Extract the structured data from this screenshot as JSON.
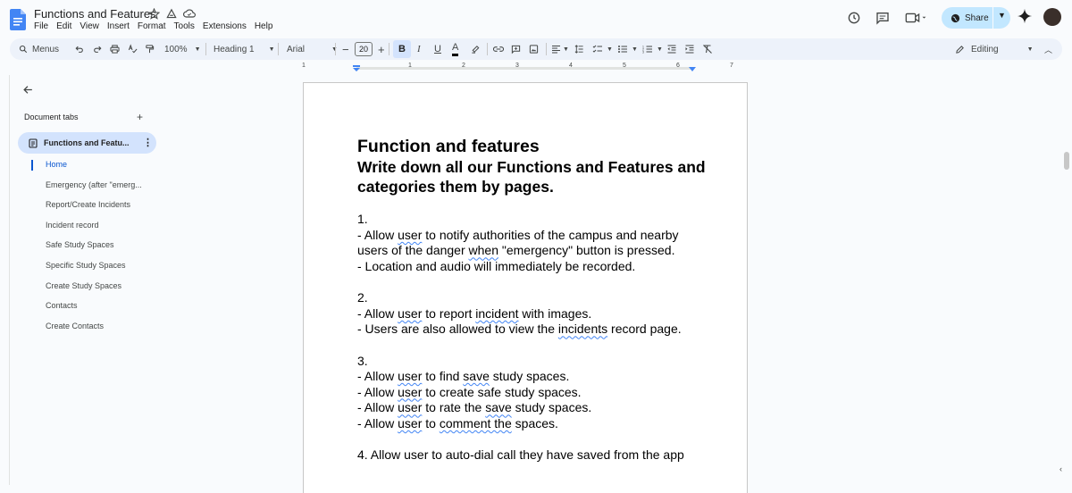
{
  "window": {
    "title": "Functions and Features",
    "menu": [
      "File",
      "Edit",
      "View",
      "Insert",
      "Format",
      "Tools",
      "Extensions",
      "Help"
    ]
  },
  "header": {
    "share_label": "Share"
  },
  "toolbar": {
    "menus_label": "Menus",
    "zoom": "100%",
    "style": "Heading 1",
    "font": "Arial",
    "font_size": "20",
    "bold": "B",
    "italic": "I",
    "underline": "U",
    "text_color": "A",
    "mode": "Editing"
  },
  "ruler": {
    "ticks": [
      "1",
      "1",
      "2",
      "3",
      "4",
      "5",
      "6",
      "7"
    ]
  },
  "sidebar": {
    "title": "Document tabs",
    "active_tab": "Functions and Featu...",
    "outline": [
      "Home",
      "Emergency (after \"emerg...",
      "Report/Create Incidents",
      "Incident record",
      "Safe Study Spaces",
      "Specific Study Spaces",
      "Create Study Spaces",
      "Contacts",
      "Create Contacts"
    ]
  },
  "document": {
    "heading1": "Function and features",
    "heading2": "Write down all our Functions and Features and categories them by pages.",
    "s1_num": "1.",
    "s1_l1_a": "- Allow ",
    "s1_l1_user": "user",
    "s1_l1_b": " to notify authorities of the campus and nearby users of the danger ",
    "s1_l1_when": "when",
    "s1_l1_c": " \"emergency\" button is pressed.",
    "s1_l2": "- Location and audio will immediately be recorded.",
    "s2_num": "2.",
    "s2_l1_a": "- Allow ",
    "s2_l1_user": "user",
    "s2_l1_b": " to report ",
    "s2_l1_incident": "incident",
    "s2_l1_c": " with images.",
    "s2_l2_a": "- Users are also allowed to view the ",
    "s2_l2_incidents": "incidents",
    "s2_l2_b": " record page.",
    "s3_num": "3.",
    "s3_l1_a": "- Allow ",
    "s3_l1_user": "user",
    "s3_l1_b": " to find ",
    "s3_l1_save": "save",
    "s3_l1_c": " study spaces.",
    "s3_l2_a": "- Allow ",
    "s3_l2_user": "user",
    "s3_l2_b": " to create safe study spaces.",
    "s3_l3_a": "- Allow ",
    "s3_l3_user": "user",
    "s3_l3_b": " to rate the ",
    "s3_l3_save": "save",
    "s3_l3_c": " study spaces.",
    "s3_l4_a": "- Allow ",
    "s3_l4_user": "user",
    "s3_l4_b": " to ",
    "s3_l4_comment": "comment the",
    "s3_l4_c": " spaces.",
    "s4": "4. Allow user to auto-dial call they have saved from the app"
  },
  "colors": {
    "accent": "#0b57d0",
    "share_bg": "#c2e7ff",
    "active_tab_bg": "#d3e3fd",
    "toolbar_bg": "#edf2fa"
  },
  "icons": [
    "docs-icon",
    "star-icon",
    "move-icon",
    "cloud-icon",
    "history-icon",
    "comment-icon",
    "meet-icon",
    "gemini-icon",
    "search-icon",
    "undo-icon",
    "redo-icon",
    "print-icon",
    "spellcheck-icon",
    "paint-format-icon",
    "pencil-icon",
    "back-arrow-icon",
    "plus-icon",
    "document-icon",
    "more-vert-icon"
  ]
}
